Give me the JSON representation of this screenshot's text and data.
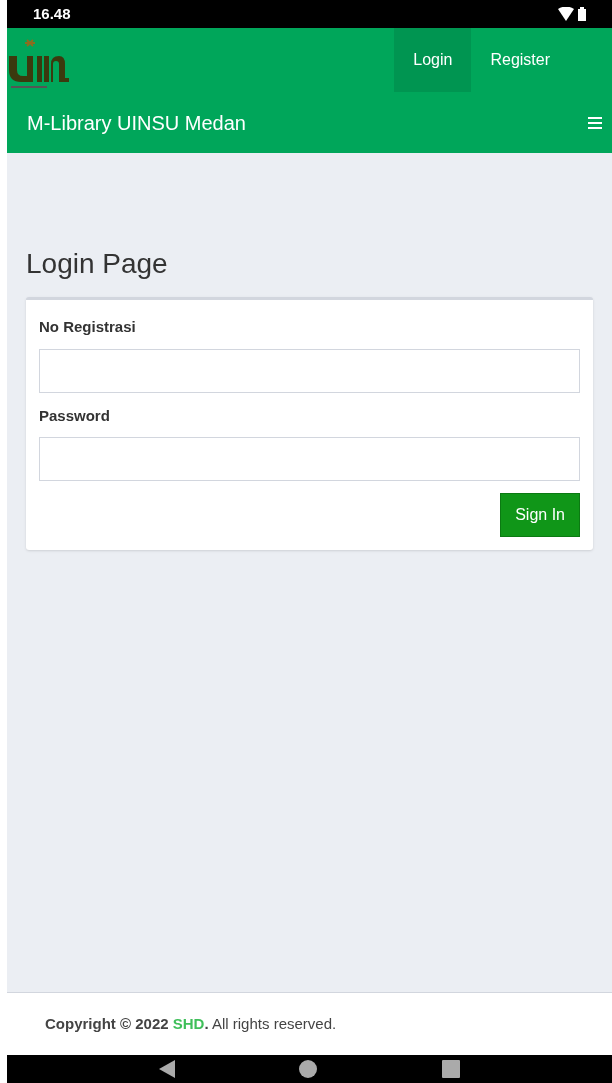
{
  "status_bar": {
    "time": "16.48"
  },
  "navbar": {
    "links": [
      {
        "label": "Login",
        "selected": true
      },
      {
        "label": "Register",
        "selected": false
      }
    ],
    "brand": "M-Library UINSU Medan"
  },
  "page": {
    "title": "Login Page",
    "fields": [
      {
        "label": "No Registrasi"
      },
      {
        "label": "Password"
      }
    ],
    "submit": "Sign In"
  },
  "footer": {
    "prefix": "**Copyright © 2022**",
    "link": "SHD",
    "suffix": "**.** All rights reserved."
  }
}
